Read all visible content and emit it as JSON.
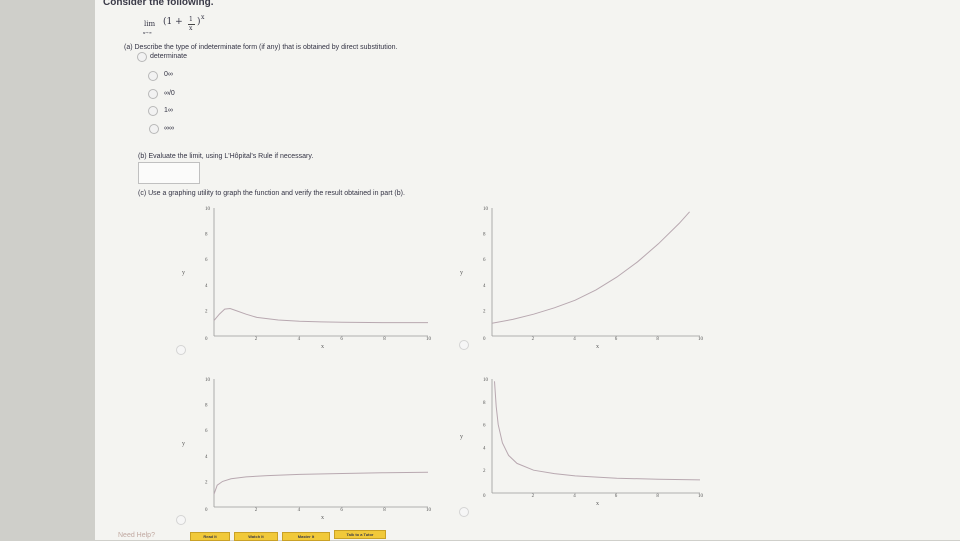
{
  "header": {
    "title": "Consider the following."
  },
  "limit": {
    "lim": "lim",
    "sub": "x→∞",
    "expr": "(1 + ",
    "num": "1",
    "den": "x",
    "close": ")",
    "exp": "x"
  },
  "part_a": {
    "question": "(a) Describe the type of indeterminate form (if any) that is obtained by direct substitution.",
    "options": [
      "determinate",
      "0∞",
      "∞/0",
      "1∞",
      "∞∞"
    ]
  },
  "part_b": {
    "question": "(b) Evaluate the limit, using L'Hôpital's Rule if necessary."
  },
  "part_c": {
    "question": "(c) Use a graphing utility to graph the function and verify the result obtained in part (b)."
  },
  "chart_data": [
    {
      "type": "line",
      "xlabel": "x",
      "ylabel": "y",
      "xticks": [
        "0",
        "2",
        "4",
        "6",
        "8",
        "10"
      ],
      "yticks": [
        "2",
        "4",
        "6",
        "8",
        "10"
      ],
      "xlim": [
        0,
        10
      ],
      "ylim": [
        0,
        10
      ],
      "x": [
        0,
        0.25,
        0.5,
        0.75,
        1,
        1.5,
        2,
        3,
        4,
        5,
        6,
        8,
        10
      ],
      "y": [
        1.2,
        1.7,
        2.1,
        2.15,
        2.0,
        1.7,
        1.45,
        1.25,
        1.15,
        1.1,
        1.07,
        1.05,
        1.05
      ]
    },
    {
      "type": "line",
      "xlabel": "x",
      "ylabel": "y",
      "xticks": [
        "0",
        "2",
        "4",
        "6",
        "8",
        "10"
      ],
      "yticks": [
        "2",
        "4",
        "6",
        "8",
        "10"
      ],
      "xlim": [
        0,
        10
      ],
      "ylim": [
        0,
        10
      ],
      "x": [
        0,
        1,
        2,
        3,
        4,
        5,
        6,
        7,
        8,
        9,
        9.5
      ],
      "y": [
        1.0,
        1.3,
        1.7,
        2.2,
        2.8,
        3.6,
        4.6,
        5.8,
        7.2,
        8.8,
        9.7
      ]
    },
    {
      "type": "line",
      "xlabel": "x",
      "ylabel": "y",
      "xticks": [
        "0",
        "2",
        "4",
        "6",
        "8",
        "10"
      ],
      "yticks": [
        "2",
        "4",
        "6",
        "8",
        "10"
      ],
      "xlim": [
        0,
        10
      ],
      "ylim": [
        0,
        10
      ],
      "x": [
        0,
        0.15,
        0.4,
        0.8,
        1.5,
        2.5,
        4,
        6,
        8,
        10
      ],
      "y": [
        1.0,
        1.7,
        2.0,
        2.2,
        2.35,
        2.45,
        2.55,
        2.62,
        2.68,
        2.72
      ]
    },
    {
      "type": "line",
      "xlabel": "x",
      "ylabel": "y",
      "xticks": [
        "0",
        "2",
        "4",
        "6",
        "8",
        "10"
      ],
      "yticks": [
        "2",
        "4",
        "6",
        "8",
        "10"
      ],
      "xlim": [
        0,
        10
      ],
      "ylim": [
        0,
        10
      ],
      "x": [
        0.12,
        0.2,
        0.3,
        0.5,
        0.8,
        1.2,
        2,
        3,
        4,
        6,
        8,
        10
      ],
      "y": [
        9.8,
        7.6,
        6.0,
        4.4,
        3.3,
        2.6,
        2.0,
        1.7,
        1.5,
        1.3,
        1.2,
        1.15
      ]
    }
  ],
  "footer": {
    "help": "Need Help?",
    "buttons": [
      "Read It",
      "Watch It",
      "Master It",
      "Talk to a Tutor"
    ]
  }
}
